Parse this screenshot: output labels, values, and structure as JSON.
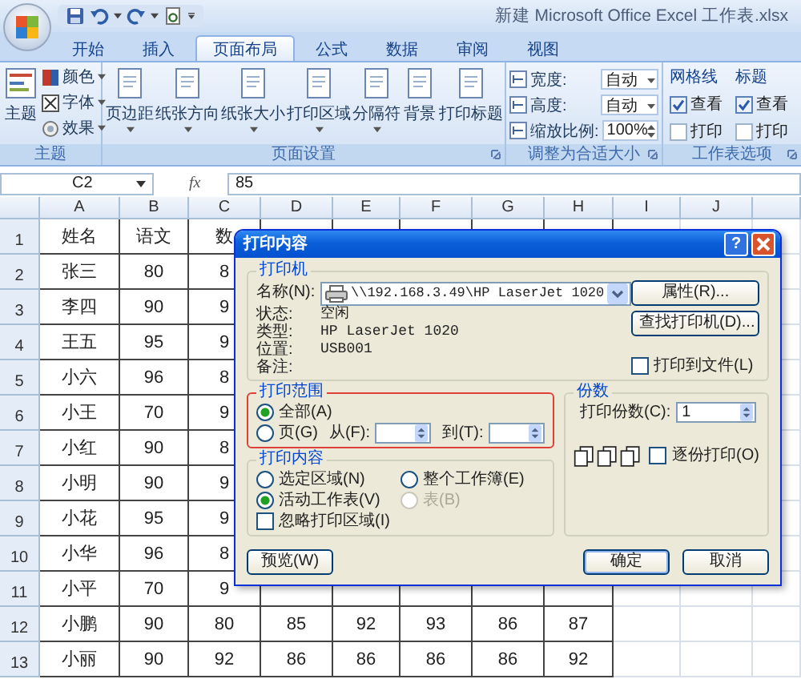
{
  "window": {
    "title": "新建 Microsoft Office Excel 工作表.xlsx"
  },
  "tabs": [
    {
      "label": "开始",
      "selected": false
    },
    {
      "label": "插入",
      "selected": false
    },
    {
      "label": "页面布局",
      "selected": true
    },
    {
      "label": "公式",
      "selected": false
    },
    {
      "label": "数据",
      "selected": false
    },
    {
      "label": "审阅",
      "selected": false
    },
    {
      "label": "视图",
      "selected": false
    }
  ],
  "ribbon": {
    "theme": {
      "label": "主题",
      "main": "主题",
      "items": [
        "颜色",
        "字体",
        "效果"
      ]
    },
    "page_setup": {
      "label": "页面设置",
      "buttons": [
        {
          "label": "页边距",
          "dropdown": true
        },
        {
          "label": "纸张方向",
          "dropdown": true
        },
        {
          "label": "纸张大小",
          "dropdown": true
        },
        {
          "label": "打印区域",
          "dropdown": true
        },
        {
          "label": "分隔符",
          "dropdown": true
        },
        {
          "label": "背景",
          "dropdown": false
        },
        {
          "label": "打印标题",
          "dropdown": false
        }
      ]
    },
    "scale": {
      "label": "调整为合适大小",
      "fields": [
        {
          "label": "宽度:",
          "value": "自动",
          "kind": "dropdown"
        },
        {
          "label": "高度:",
          "value": "自动",
          "kind": "dropdown"
        },
        {
          "label": "缩放比例:",
          "value": "100%",
          "kind": "spinner"
        }
      ]
    },
    "sheet_options": {
      "label": "工作表选项",
      "columns": [
        {
          "title": "网格线",
          "options": [
            {
              "label": "查看",
              "checked": true
            },
            {
              "label": "打印",
              "checked": false
            }
          ]
        },
        {
          "title": "标题",
          "options": [
            {
              "label": "查看",
              "checked": true
            },
            {
              "label": "打印",
              "checked": false
            }
          ]
        }
      ]
    }
  },
  "formula_bar": {
    "name_box": "C2",
    "function_label": "fx",
    "formula": "85"
  },
  "sheet": {
    "columns": [
      "A",
      "B",
      "C",
      "D",
      "E",
      "F",
      "G",
      "H",
      "I",
      "J"
    ],
    "rows": [
      {
        "header": "1",
        "cells": [
          "姓名",
          "语文",
          "数"
        ]
      },
      {
        "header": "2",
        "cells": [
          "张三",
          "80",
          "8"
        ]
      },
      {
        "header": "3",
        "cells": [
          "李四",
          "90",
          "9"
        ]
      },
      {
        "header": "4",
        "cells": [
          "王五",
          "95",
          "9"
        ]
      },
      {
        "header": "5",
        "cells": [
          "小六",
          "96",
          "8"
        ]
      },
      {
        "header": "6",
        "cells": [
          "小王",
          "70",
          "9"
        ]
      },
      {
        "header": "7",
        "cells": [
          "小红",
          "90",
          "8"
        ]
      },
      {
        "header": "8",
        "cells": [
          "小明",
          "90",
          "9"
        ]
      },
      {
        "header": "9",
        "cells": [
          "小花",
          "95",
          "9"
        ]
      },
      {
        "header": "10",
        "cells": [
          "小华",
          "96",
          "8"
        ]
      },
      {
        "header": "11",
        "cells": [
          "小平",
          "70",
          "9"
        ]
      },
      {
        "header": "12",
        "cells": [
          "小鹏",
          "90",
          "80",
          "85",
          "92",
          "93",
          "86",
          "87"
        ]
      },
      {
        "header": "13",
        "cells": [
          "小丽",
          "90",
          "92",
          "86",
          "86",
          "86",
          "86",
          "92"
        ]
      }
    ]
  },
  "print_dialog": {
    "title": "打印内容",
    "help": "?",
    "printer": {
      "group": "打印机",
      "name_label": "名称(N):",
      "name_value": "\\\\192.168.3.49\\HP LaserJet 1020",
      "info": [
        {
          "label": "状态:",
          "value": "空闲"
        },
        {
          "label": "类型:",
          "value": "HP LaserJet 1020"
        },
        {
          "label": "位置:",
          "value": "USB001"
        },
        {
          "label": "备注:"
        }
      ],
      "buttons": [
        "属性(R)...",
        "查找打印机(D)..."
      ],
      "print_to_file": {
        "label": "打印到文件(L)",
        "checked": false
      }
    },
    "range": {
      "group": "打印范围",
      "options": [
        {
          "label": "全部(A)",
          "selected": true
        },
        {
          "label": "页(G)",
          "selected": false
        }
      ],
      "from_label": "从(F):",
      "to_label": "到(T):"
    },
    "copies": {
      "group": "份数",
      "count_label": "打印份数(C):",
      "count": "1",
      "collate": {
        "label": "逐份打印(O)",
        "checked": false
      }
    },
    "content": {
      "group": "打印内容",
      "options": [
        {
          "label": "选定区域(N)",
          "selected": false,
          "disabled": false
        },
        {
          "label": "整个工作簿(E)",
          "selected": false,
          "disabled": false
        },
        {
          "label": "活动工作表(V)",
          "selected": true,
          "disabled": false
        },
        {
          "label": "表(B)",
          "selected": false,
          "disabled": true
        }
      ],
      "ignore_area": {
        "label": "忽略打印区域(I)",
        "checked": false
      }
    },
    "buttons": [
      {
        "label": "预览(W)",
        "default": false
      },
      {
        "label": "确定",
        "default": true
      },
      {
        "label": "取消",
        "default": false
      }
    ]
  }
}
